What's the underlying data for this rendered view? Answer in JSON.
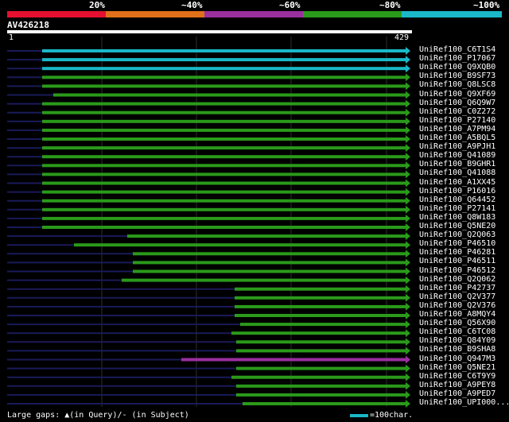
{
  "colors": {
    "red": "#e5102f",
    "orange": "#e0701a",
    "purple": "#9a2f9e",
    "green": "#2a9a1a",
    "cyan": "#1ab8c8",
    "navy": "#1a1a5a",
    "grid": "#2a2a2a"
  },
  "legend": {
    "labels": [
      "20%",
      "~40%",
      "~60%",
      "~80%",
      "~100%"
    ],
    "segments": [
      "red",
      "orange",
      "purple",
      "green",
      "cyan"
    ]
  },
  "query": {
    "name": "AV426218",
    "start": "1",
    "end": "429"
  },
  "hits": [
    {
      "name": "UniRef100_C6T1S4",
      "color": "cyan"
    },
    {
      "name": "UniRef100_P17067",
      "color": "cyan"
    },
    {
      "name": "UniRef100_Q9XQB0",
      "color": "cyan"
    },
    {
      "name": "UniRef100_B9SF73",
      "color": "green"
    },
    {
      "name": "UniRef100_Q8LSC8",
      "color": "green"
    },
    {
      "name": "UniRef100_Q9XF69",
      "color": "green"
    },
    {
      "name": "UniRef100_Q6Q9W7",
      "color": "green"
    },
    {
      "name": "UniRef100_C0Z272",
      "color": "green"
    },
    {
      "name": "UniRef100_P27140",
      "color": "green"
    },
    {
      "name": "UniRef100_A7PM94",
      "color": "green"
    },
    {
      "name": "UniRef100_A5BQL5",
      "color": "green"
    },
    {
      "name": "UniRef100_A9PJH1",
      "color": "green"
    },
    {
      "name": "UniRef100_Q41089",
      "color": "green"
    },
    {
      "name": "UniRef100_B9GHR1",
      "color": "green"
    },
    {
      "name": "UniRef100_Q41088",
      "color": "green"
    },
    {
      "name": "UniRef100_A1XX45",
      "color": "green"
    },
    {
      "name": "UniRef100_P16016",
      "color": "green"
    },
    {
      "name": "UniRef100_Q64452",
      "color": "green"
    },
    {
      "name": "UniRef100_P27141",
      "color": "green"
    },
    {
      "name": "UniRef100_Q8W183",
      "color": "green"
    },
    {
      "name": "UniRef100_Q5NE20",
      "color": "green"
    },
    {
      "name": "UniRef100_Q2Q063",
      "color": "green"
    },
    {
      "name": "UniRef100_P46510",
      "color": "green"
    },
    {
      "name": "UniRef100_P46281",
      "color": "green"
    },
    {
      "name": "UniRef100_P46511",
      "color": "green"
    },
    {
      "name": "UniRef100_P46512",
      "color": "green"
    },
    {
      "name": "UniRef100_Q2Q062",
      "color": "green"
    },
    {
      "name": "UniRef100_P42737",
      "color": "green"
    },
    {
      "name": "UniRef100_Q2V377",
      "color": "green"
    },
    {
      "name": "UniRef100_Q2V376",
      "color": "green"
    },
    {
      "name": "UniRef100_A8MQY4",
      "color": "green"
    },
    {
      "name": "UniRef100_Q56X90",
      "color": "green"
    },
    {
      "name": "UniRef100_C6TC08",
      "color": "green"
    },
    {
      "name": "UniRef100_Q84Y09",
      "color": "green"
    },
    {
      "name": "UniRef100_B9SHA8",
      "color": "green"
    },
    {
      "name": "UniRef100_Q947M3",
      "color": "purple"
    },
    {
      "name": "UniRef100_Q5NE21",
      "color": "green"
    },
    {
      "name": "UniRef100_C6T9Y9",
      "color": "green"
    },
    {
      "name": "UniRef100_A9PEY8",
      "color": "green"
    },
    {
      "name": "UniRef100_A9PED7",
      "color": "green"
    },
    {
      "name": "UniRef100_UPI000...",
      "color": "green"
    }
  ],
  "footer": {
    "gaps_text": "Large gaps: ▲(in Query)/- (in Subject)",
    "scale_text": "=100char.",
    "scale_color": "cyan"
  }
}
